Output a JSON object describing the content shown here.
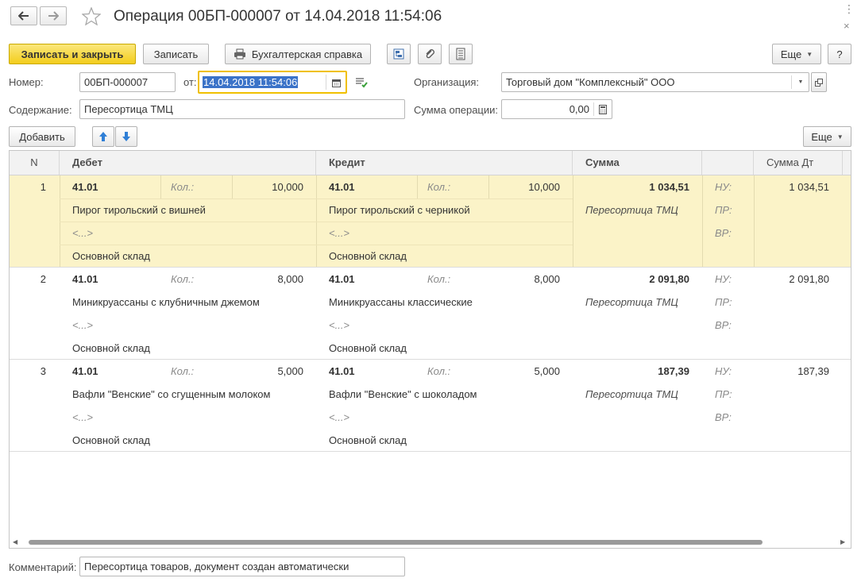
{
  "window": {
    "title": "Операция 00БП-000007 от 14.04.2018 11:54:06"
  },
  "toolbar": {
    "save_close_label": "Записать и закрыть",
    "save_label": "Записать",
    "report_label": "Бухгалтерская справка",
    "more_label": "Еще",
    "help_label": "?"
  },
  "form": {
    "number_label": "Номер:",
    "number_value": "00БП-000007",
    "date_label": "от:",
    "date_value": "14.04.2018 11:54:06",
    "org_label": "Организация:",
    "org_value": "Торговый дом \"Комплексный\" ООО",
    "content_label": "Содержание:",
    "content_value": "Пересортица ТМЦ",
    "sum_label": "Сумма операции:",
    "sum_value": "0,00"
  },
  "table_toolbar": {
    "add_label": "Добавить",
    "more_label": "Еще"
  },
  "table": {
    "columns": {
      "n": "N",
      "debit": "Дебет",
      "credit": "Кредит",
      "sum": "Сумма",
      "sum_dt": "Сумма Дт"
    },
    "rows": [
      {
        "n": "1",
        "debit_account": "41.01",
        "debit_qty_label": "Кол.:",
        "debit_qty": "10,000",
        "debit_sub1": "Пирог тирольский с вишней",
        "debit_sub2": "<...>",
        "debit_sub3": "Основной склад",
        "credit_account": "41.01",
        "credit_qty_label": "Кол.:",
        "credit_qty": "10,000",
        "credit_sub1": "Пирог тирольский с черникой",
        "credit_sub2": "<...>",
        "credit_sub3": "Основной склад",
        "sum": "1 034,51",
        "content": "Пересортица ТМЦ",
        "nu_label": "НУ:",
        "pr_label": "ПР:",
        "vr_label": "ВР:",
        "sum_dt": "1 034,51"
      },
      {
        "n": "2",
        "debit_account": "41.01",
        "debit_qty_label": "Кол.:",
        "debit_qty": "8,000",
        "debit_sub1": "Миникруассаны с клубничным джемом",
        "debit_sub2": "<...>",
        "debit_sub3": "Основной склад",
        "credit_account": "41.01",
        "credit_qty_label": "Кол.:",
        "credit_qty": "8,000",
        "credit_sub1": "Миникруассаны классические",
        "credit_sub2": "<...>",
        "credit_sub3": "Основной склад",
        "sum": "2 091,80",
        "content": "Пересортица ТМЦ",
        "nu_label": "НУ:",
        "pr_label": "ПР:",
        "vr_label": "ВР:",
        "sum_dt": "2 091,80"
      },
      {
        "n": "3",
        "debit_account": "41.01",
        "debit_qty_label": "Кол.:",
        "debit_qty": "5,000",
        "debit_sub1": "Вафли \"Венские\" со сгущенным молоком",
        "debit_sub2": "<...>",
        "debit_sub3": "Основной склад",
        "credit_account": "41.01",
        "credit_qty_label": "Кол.:",
        "credit_qty": "5,000",
        "credit_sub1": "Вафли \"Венские\" с шоколадом",
        "credit_sub2": "<...>",
        "credit_sub3": "Основной склад",
        "sum": "187,39",
        "content": "Пересортица ТМЦ",
        "nu_label": "НУ:",
        "pr_label": "ПР:",
        "vr_label": "ВР:",
        "sum_dt": "187,39"
      }
    ]
  },
  "footer": {
    "comment_label": "Комментарий:",
    "comment_value": "Пересортица товаров, документ создан автоматически"
  },
  "colors": {
    "primary_button": "#f3cd1c",
    "selected_row": "#fbf3c8",
    "focus_border": "#f0c000",
    "selection": "#3b73c8",
    "arrow_blue": "#2f7fd6"
  },
  "icons": [
    "back-arrow-icon",
    "forward-arrow-icon",
    "star-icon",
    "printer-icon",
    "structure-icon",
    "paperclip-icon",
    "document-list-icon",
    "calendar-icon",
    "list-check-icon",
    "dropdown-icon",
    "open-icon",
    "calculator-icon",
    "arrow-up-icon",
    "arrow-down-icon"
  ]
}
